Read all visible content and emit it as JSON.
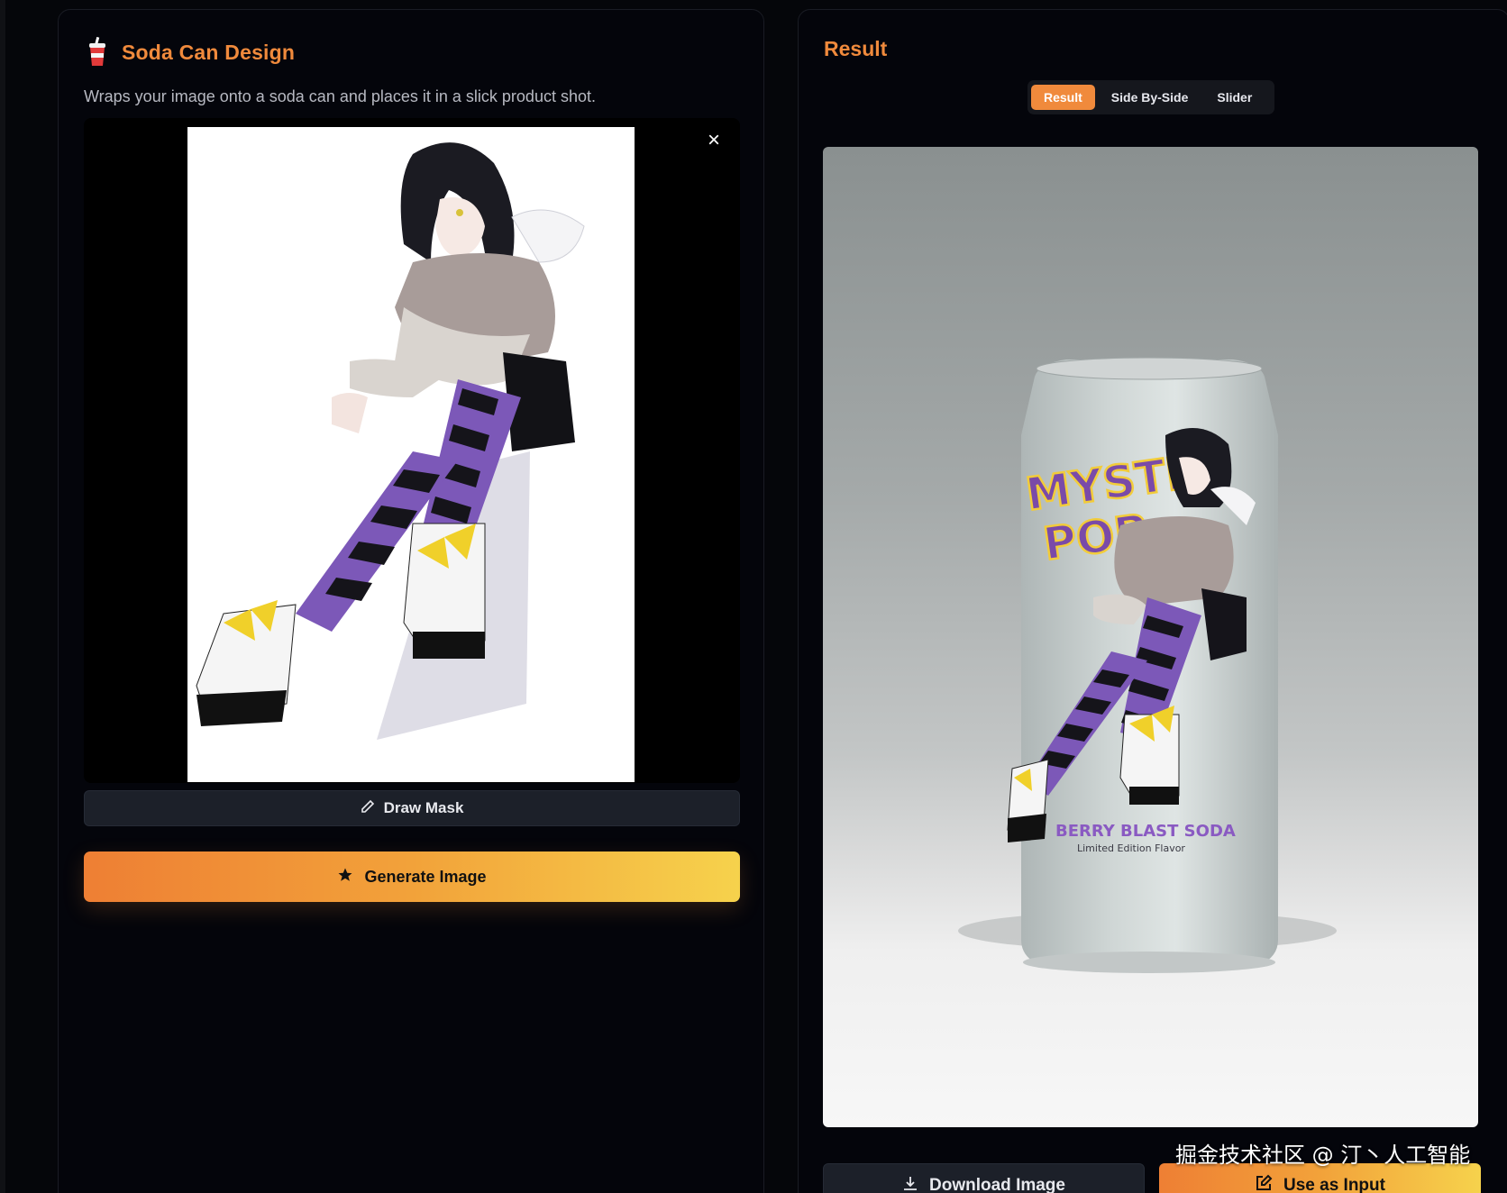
{
  "left_panel": {
    "tool_icon": "soda-cup-icon",
    "title": "Soda Can Design",
    "description": "Wraps your image onto a soda can and places it in a slick product shot.",
    "close_icon": "×",
    "draw_mask_label": "Draw Mask",
    "draw_mask_icon": "pencil-icon",
    "generate_label": "Generate Image",
    "generate_icon": "star-icon"
  },
  "right_panel": {
    "title": "Result",
    "tabs": [
      {
        "label": "Result",
        "active": true
      },
      {
        "label": "Side By-Side",
        "active": false
      },
      {
        "label": "Slider",
        "active": false
      }
    ],
    "can": {
      "brand_line1": "MYSTIC",
      "brand_line2": "POP",
      "flavor": "BERRY BLAST SODA",
      "edition": "Limited Edition Flavor"
    },
    "download_label": "Download Image",
    "download_icon": "download-icon",
    "use_input_label": "Use as Input",
    "use_input_icon": "edit-external-icon"
  },
  "watermark": "掘金技术社区 @ 汀丶人工智能",
  "colors": {
    "accent": "#f08a3c",
    "gradient_start": "#ee7f34",
    "gradient_end": "#f6d24c",
    "background": "#04050b"
  }
}
